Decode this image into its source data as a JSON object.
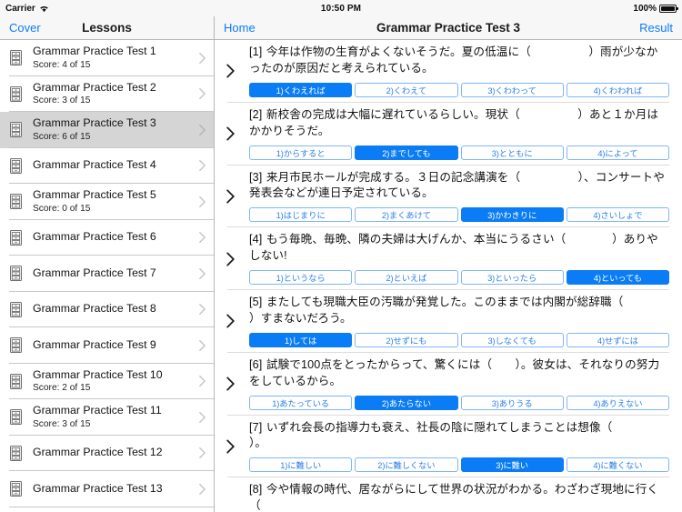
{
  "status_bar": {
    "carrier": "Carrier",
    "wifi_icon": "wifi-icon",
    "time": "10:50 PM",
    "battery_percent": "100%",
    "battery_icon": "battery-full-icon"
  },
  "sidebar": {
    "back_label": "Cover",
    "title": "Lessons",
    "item_icon": "file-cabinet-icon",
    "disclosure_icon": "chevron-right-icon",
    "items": [
      {
        "title": "Grammar Practice Test 1",
        "score": "Score: 4 of 15",
        "selected": false
      },
      {
        "title": "Grammar Practice Test 2",
        "score": "Score: 3 of 15",
        "selected": false
      },
      {
        "title": "Grammar Practice Test 3",
        "score": "Score: 6 of 15",
        "selected": true
      },
      {
        "title": "Grammar Practice Test 4",
        "score": "",
        "selected": false
      },
      {
        "title": "Grammar Practice Test 5",
        "score": "Score: 0 of 15",
        "selected": false
      },
      {
        "title": "Grammar Practice Test 6",
        "score": "",
        "selected": false
      },
      {
        "title": "Grammar Practice Test 7",
        "score": "",
        "selected": false
      },
      {
        "title": "Grammar Practice Test 8",
        "score": "",
        "selected": false
      },
      {
        "title": "Grammar Practice Test 9",
        "score": "",
        "selected": false
      },
      {
        "title": "Grammar Practice Test 10",
        "score": "Score: 2 of 15",
        "selected": false
      },
      {
        "title": "Grammar Practice Test 11",
        "score": "Score: 3 of 15",
        "selected": false
      },
      {
        "title": "Grammar Practice Test 12",
        "score": "",
        "selected": false
      },
      {
        "title": "Grammar Practice Test 13",
        "score": "",
        "selected": false
      }
    ]
  },
  "main": {
    "back_label": "Home",
    "title": "Grammar Practice Test 3",
    "result_label": "Result",
    "question_disclosure_icon": "chevron-right-icon",
    "questions": [
      {
        "number": "[1]",
        "text": "今年は作物の生育がよくないそうだ。夏の低温に（　　　　　）雨が少なかったのが原因だと考えられている。",
        "choices": [
          "1)くわえれば",
          "2)くわえて",
          "3)くわわって",
          "4)くわわれば"
        ],
        "selected_index": 0
      },
      {
        "number": "[2]",
        "text": "新校舎の完成は大幅に遅れているらしい。現状（　　　　　）あと１か月はかかりそうだ。",
        "choices": [
          "1)からすると",
          "2)までしても",
          "3)とともに",
          "4)によって"
        ],
        "selected_index": 1
      },
      {
        "number": "[3]",
        "text": "来月市民ホールが完成する。３日の記念講演を（　　　　　）、コンサートや発表会などが連日予定されている。",
        "choices": [
          "1)はじまりに",
          "2)まくあけて",
          "3)かわきりに",
          "4)さいしょで"
        ],
        "selected_index": 2
      },
      {
        "number": "[4]",
        "text": "もう毎晩、毎晩、隣の夫婦は大げんか、本当にうるさい（　　　　）ありやしない!",
        "choices": [
          "1)というなら",
          "2)といえば",
          "3)といったら",
          "4)といっても"
        ],
        "selected_index": 3
      },
      {
        "number": "[5]",
        "text": "またしても現職大臣の汚職が発覚した。このままでは内閣が総辞職（　　　　）すまないだろう。",
        "choices": [
          "1)しては",
          "2)せずにも",
          "3)しなくても",
          "4)せずには"
        ],
        "selected_index": 0
      },
      {
        "number": "[6]",
        "text": "試験で100点をとったからって、驚くには（　　）。彼女は、それなりの努力をしているから。",
        "choices": [
          "1)あたっている",
          "2)あたらない",
          "3)ありうる",
          "4)ありえない"
        ],
        "selected_index": 1
      },
      {
        "number": "[7]",
        "text": "いずれ会長の指導力も衰え、社長の陰に隠れてしまうことは想像（　　　　　　）。",
        "choices": [
          "1)に難しい",
          "2)に難しくない",
          "3)に難い",
          "4)に難くない"
        ],
        "selected_index": 2
      },
      {
        "number": "[8]",
        "text": "今や情報の時代、居ながらにして世界の状況がわかる。わざわざ現地に行く（",
        "choices": [],
        "selected_index": -1
      }
    ]
  },
  "colors": {
    "accent_blue": "#0b7bfb",
    "selected_choice_bg": "#0a7cf5",
    "choice_border": "#7fb5f7",
    "choice_text": "#2f7fe6",
    "selected_row_bg": "#d5d5d5",
    "nav_bar_bg": "#f7f7f7"
  }
}
